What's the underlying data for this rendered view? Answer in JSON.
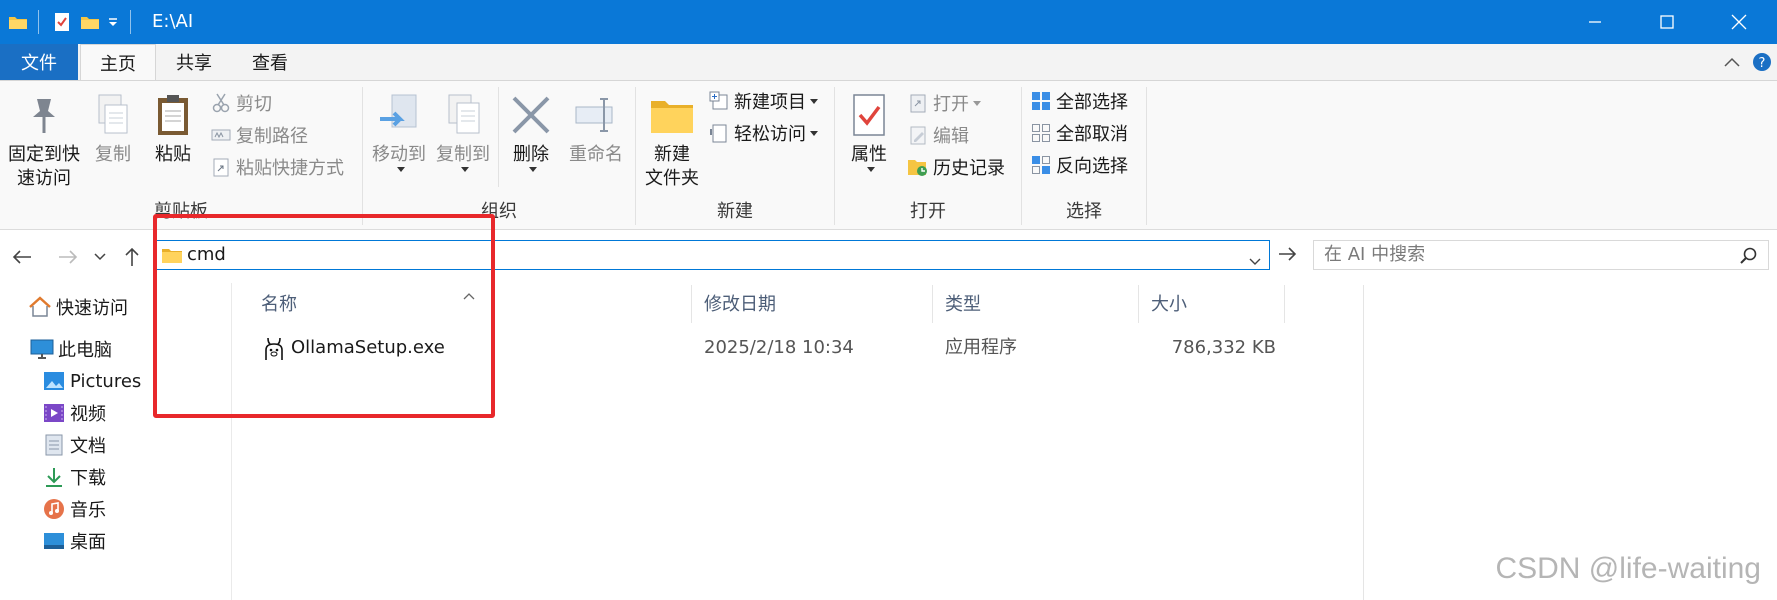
{
  "window": {
    "title_path": "E:\\AI",
    "controls": {
      "minimize": "minimize",
      "maximize": "maximize",
      "close": "close"
    }
  },
  "ribbon_tabs": {
    "file": "文件",
    "home": "主页",
    "share": "共享",
    "view": "查看"
  },
  "ribbon": {
    "clipboard": {
      "label": "剪贴板",
      "pin": "固定到快速访问",
      "pin_line1": "固定到快",
      "pin_line2": "速访问",
      "copy": "复制",
      "paste": "粘贴",
      "cut": "剪切",
      "copy_path": "复制路径",
      "paste_shortcut": "粘贴快捷方式"
    },
    "organize": {
      "label": "组织",
      "move_to": "移动到",
      "copy_to": "复制到",
      "delete": "删除",
      "rename": "重命名"
    },
    "new": {
      "label": "新建",
      "new_folder_line1": "新建",
      "new_folder_line2": "文件夹",
      "new_item": "新建项目",
      "easy_access": "轻松访问"
    },
    "open": {
      "label": "打开",
      "properties": "属性",
      "open": "打开",
      "edit": "编辑",
      "history": "历史记录"
    },
    "select": {
      "label": "选择",
      "select_all": "全部选择",
      "select_none": "全部取消",
      "invert": "反向选择"
    }
  },
  "address_bar": {
    "value": "cmd",
    "search_placeholder": "在 AI 中搜索"
  },
  "nav_pane": {
    "items": [
      {
        "label": "快速访问",
        "icon": "star-home-icon"
      },
      {
        "label": "此电脑",
        "icon": "computer-icon"
      },
      {
        "label": "Pictures",
        "icon": "pictures-icon"
      },
      {
        "label": "视频",
        "icon": "videos-icon"
      },
      {
        "label": "文档",
        "icon": "documents-icon"
      },
      {
        "label": "下载",
        "icon": "downloads-icon"
      },
      {
        "label": "音乐",
        "icon": "music-icon"
      },
      {
        "label": "桌面",
        "icon": "desktop-icon"
      }
    ]
  },
  "file_list": {
    "columns": [
      "名称",
      "修改日期",
      "类型",
      "大小"
    ],
    "rows": [
      {
        "name": "OllamaSetup.exe",
        "modified": "2025/2/18 10:34",
        "type": "应用程序",
        "size": "786,332 KB",
        "icon": "ollama-icon"
      }
    ]
  },
  "watermark": "CSDN @life-waiting",
  "colors": {
    "titlebar": "#0a78d7",
    "file_tab": "#1a6fc4",
    "highlight": "#e8282b",
    "accent": "#0078d7"
  }
}
